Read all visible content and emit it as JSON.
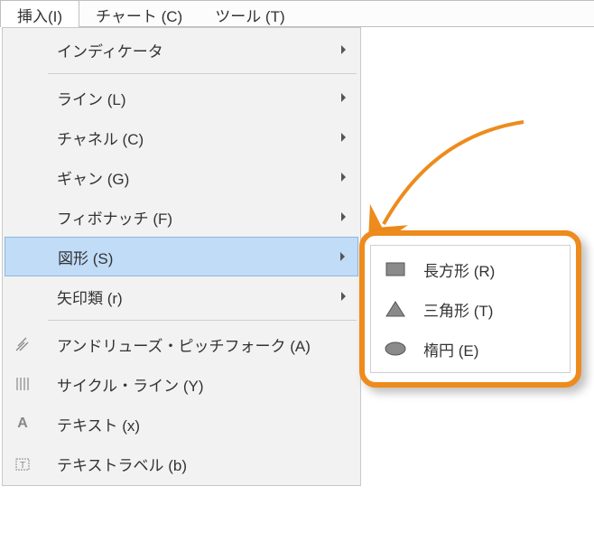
{
  "menubar": {
    "insert": "挿入(I)",
    "chart": "チャート (C)",
    "tool": "ツール (T)"
  },
  "menu": {
    "indicator": "インディケータ",
    "line": "ライン (L)",
    "channel": "チャネル (C)",
    "gann": "ギャン (G)",
    "fibonacci": "フィボナッチ (F)",
    "shapes": "図形 (S)",
    "arrows": "矢印類 (r)",
    "andrews": "アンドリューズ・ピッチフォーク (A)",
    "cycle": "サイクル・ライン (Y)",
    "text": "テキスト (x)",
    "textlabel": "テキストラベル (b)"
  },
  "submenu": {
    "rectangle": "長方形 (R)",
    "triangle": "三角形 (T)",
    "ellipse": "楕円 (E)"
  }
}
